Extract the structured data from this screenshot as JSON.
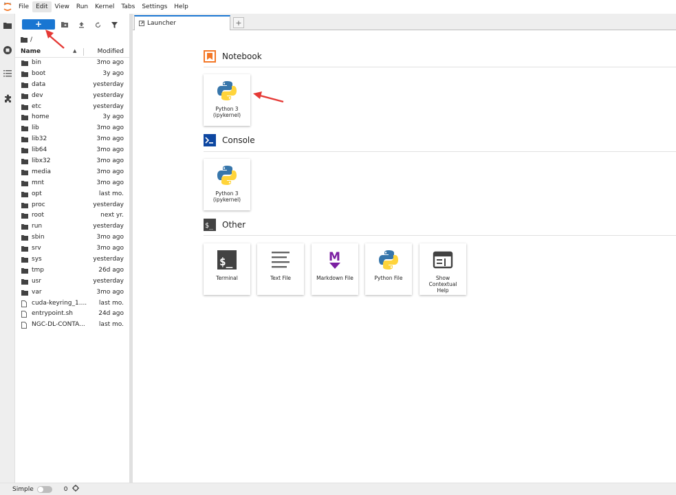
{
  "menubar": {
    "items": [
      "File",
      "Edit",
      "View",
      "Run",
      "Kernel",
      "Tabs",
      "Settings",
      "Help"
    ],
    "active_index": 1
  },
  "activity_icons": [
    "folder-icon",
    "running-icon",
    "toc-icon",
    "extension-icon"
  ],
  "file_browser": {
    "new_button_label": "+",
    "toolbar_icons": [
      "new-folder-icon",
      "upload-icon",
      "refresh-icon",
      "filter-icon"
    ],
    "breadcrumb": "/",
    "columns": {
      "name": "Name",
      "modified": "Modified"
    },
    "files": [
      {
        "name": "bin",
        "type": "folder",
        "modified": "3mo ago"
      },
      {
        "name": "boot",
        "type": "folder",
        "modified": "3y ago"
      },
      {
        "name": "data",
        "type": "folder",
        "modified": "yesterday"
      },
      {
        "name": "dev",
        "type": "folder",
        "modified": "yesterday"
      },
      {
        "name": "etc",
        "type": "folder",
        "modified": "yesterday"
      },
      {
        "name": "home",
        "type": "folder",
        "modified": "3y ago"
      },
      {
        "name": "lib",
        "type": "folder",
        "modified": "3mo ago"
      },
      {
        "name": "lib32",
        "type": "folder",
        "modified": "3mo ago"
      },
      {
        "name": "lib64",
        "type": "folder",
        "modified": "3mo ago"
      },
      {
        "name": "libx32",
        "type": "folder",
        "modified": "3mo ago"
      },
      {
        "name": "media",
        "type": "folder",
        "modified": "3mo ago"
      },
      {
        "name": "mnt",
        "type": "folder",
        "modified": "3mo ago"
      },
      {
        "name": "opt",
        "type": "folder",
        "modified": "last mo."
      },
      {
        "name": "proc",
        "type": "folder",
        "modified": "yesterday"
      },
      {
        "name": "root",
        "type": "folder",
        "modified": "next yr."
      },
      {
        "name": "run",
        "type": "folder",
        "modified": "yesterday"
      },
      {
        "name": "sbin",
        "type": "folder",
        "modified": "3mo ago"
      },
      {
        "name": "srv",
        "type": "folder",
        "modified": "3mo ago"
      },
      {
        "name": "sys",
        "type": "folder",
        "modified": "yesterday"
      },
      {
        "name": "tmp",
        "type": "folder",
        "modified": "26d ago"
      },
      {
        "name": "usr",
        "type": "folder",
        "modified": "yesterday"
      },
      {
        "name": "var",
        "type": "folder",
        "modified": "3mo ago"
      },
      {
        "name": "cuda-keyring_1....",
        "type": "file",
        "modified": "last mo."
      },
      {
        "name": "entrypoint.sh",
        "type": "file",
        "modified": "24d ago"
      },
      {
        "name": "NGC-DL-CONTA...",
        "type": "file",
        "modified": "last mo."
      }
    ]
  },
  "tabs": [
    {
      "label": "Launcher"
    }
  ],
  "add_tab_label": "+",
  "launcher": {
    "sections": [
      {
        "title": "Notebook",
        "icon": "notebook-icon",
        "cards": [
          {
            "label1": "Python 3",
            "label2": "(ipykernel)",
            "icon": "python-icon"
          }
        ]
      },
      {
        "title": "Console",
        "icon": "console-icon",
        "cards": [
          {
            "label1": "Python 3",
            "label2": "(ipykernel)",
            "icon": "python-icon"
          }
        ]
      },
      {
        "title": "Other",
        "icon": "terminal-small-icon",
        "cards": [
          {
            "label1": "Terminal",
            "icon": "terminal-icon"
          },
          {
            "label1": "Text File",
            "icon": "text-file-icon"
          },
          {
            "label1": "Markdown File",
            "icon": "markdown-icon"
          },
          {
            "label1": "Python File",
            "icon": "python-icon"
          },
          {
            "label1": "Show",
            "label2": "Contextual",
            "label3": "Help",
            "icon": "contextual-help-icon"
          }
        ]
      }
    ]
  },
  "statusbar": {
    "simple_label": "Simple",
    "kernel_count": "0"
  },
  "colors": {
    "accent": "#1976d2",
    "notebook_orange": "#f37726",
    "console_blue": "#0d47a1",
    "markdown_purple": "#7b1fa2",
    "arrow_red": "#e53935"
  }
}
